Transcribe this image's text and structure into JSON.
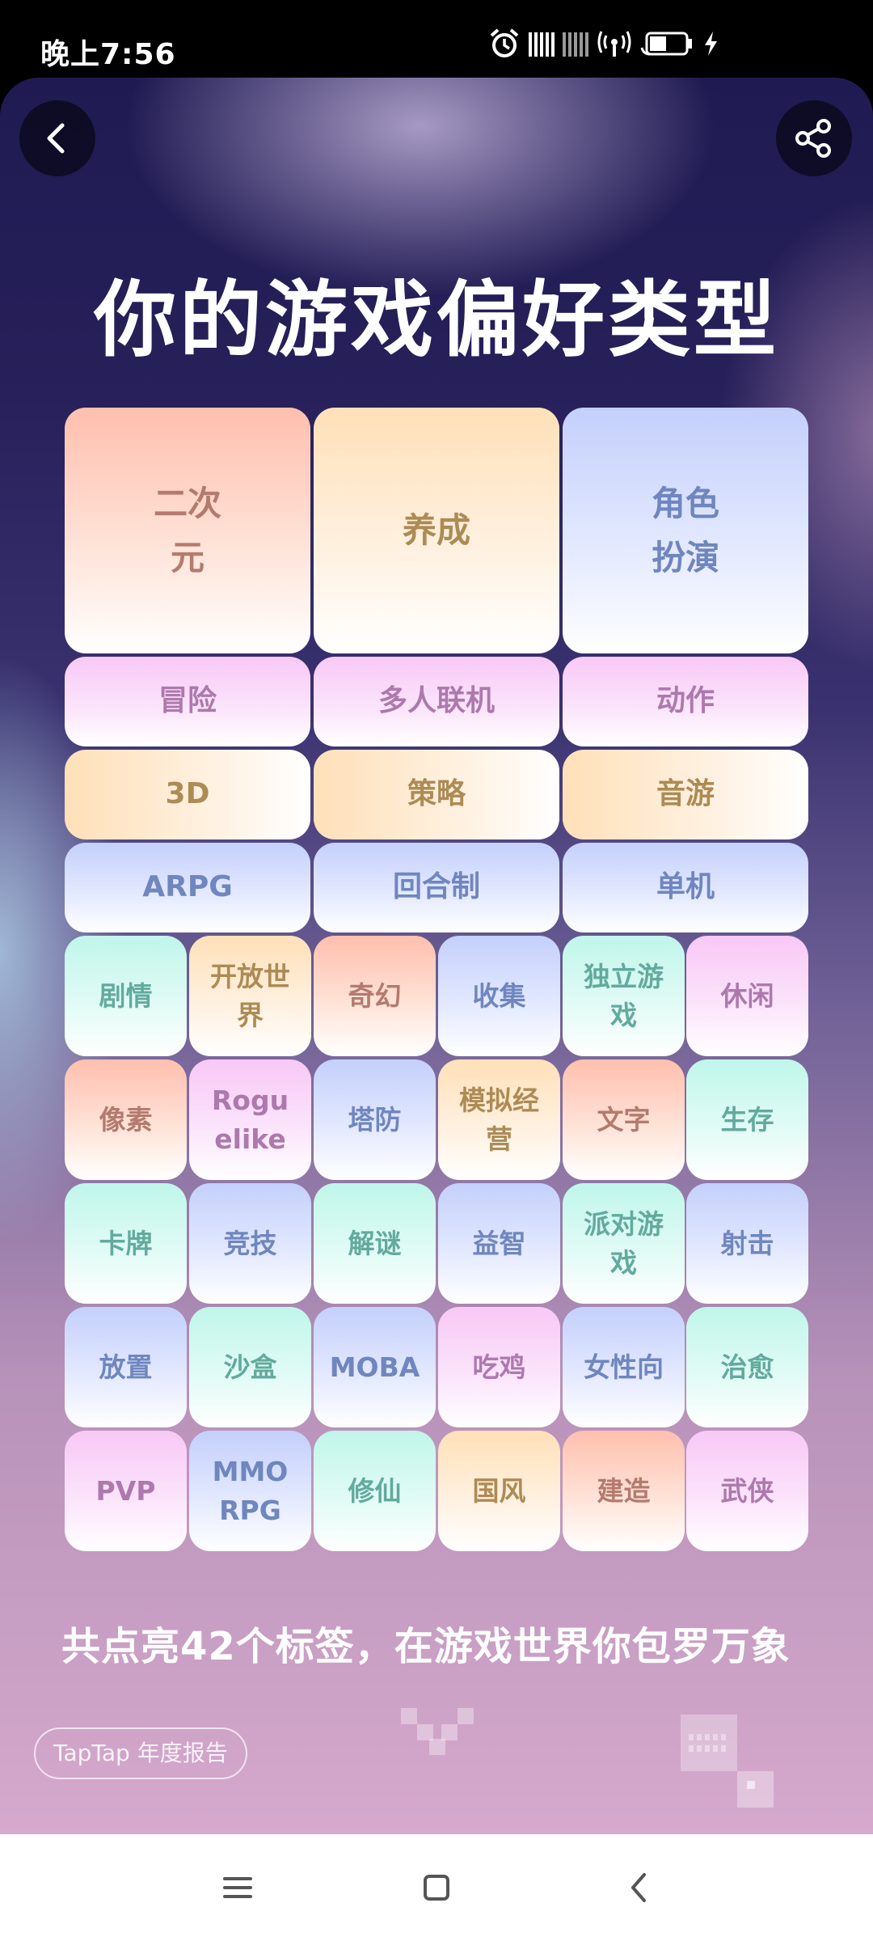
{
  "status_bar": {
    "time": "晚上7:56",
    "battery": "56"
  },
  "header": {
    "back_icon": "chevron-left-icon",
    "share_icon": "share-icon"
  },
  "title": "你的游戏偏好类型",
  "tags": {
    "big": [
      "二次\n元",
      "养成",
      "角色\n扮演"
    ],
    "row1": [
      "冒险",
      "多人联机",
      "动作"
    ],
    "row2": [
      "3D",
      "策略",
      "音游"
    ],
    "row3": [
      "ARPG",
      "回合制",
      "单机"
    ],
    "small": [
      [
        "剧情",
        "开放世\n界",
        "奇幻",
        "收集",
        "独立游\n戏",
        "休闲"
      ],
      [
        "像素",
        "Rogu\nelike",
        "塔防",
        "模拟经\n营",
        "文字",
        "生存"
      ],
      [
        "卡牌",
        "竞技",
        "解谜",
        "益智",
        "派对游\n戏",
        "射击"
      ],
      [
        "放置",
        "沙盒",
        "MOBA",
        "吃鸡",
        "女性向",
        "治愈"
      ],
      [
        "PVP",
        "MMO\nRPG",
        "修仙",
        "国风",
        "建造",
        "武侠"
      ]
    ]
  },
  "summary": "共点亮42个标签，在游戏世界你包罗万象",
  "footer": {
    "brand": "TapTap 年度报告"
  },
  "nav": [
    "menu-icon",
    "home-icon",
    "back-icon"
  ]
}
